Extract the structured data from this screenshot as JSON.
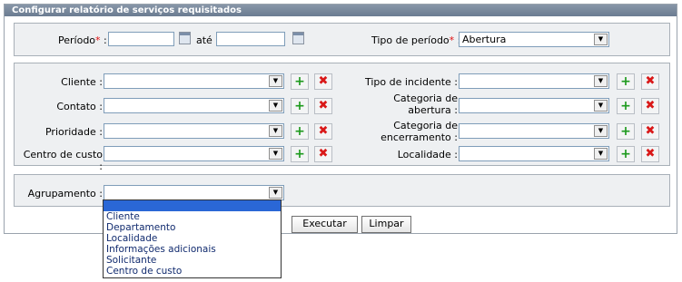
{
  "panel": {
    "title": "Configurar relatório de serviços requisitados"
  },
  "period": {
    "label": "Período",
    "required_mark": "*",
    "colon": ":",
    "ate": "até",
    "start_value": "",
    "end_value": "",
    "type_label": "Tipo de período",
    "type_value": "Abertura"
  },
  "filters": {
    "cliente": {
      "label": "Cliente :",
      "value": ""
    },
    "contato": {
      "label": "Contato :",
      "value": ""
    },
    "prioridade": {
      "label": "Prioridade :",
      "value": ""
    },
    "centro_custo": {
      "label": "Centro de custo :",
      "value": ""
    },
    "tipo_incidente": {
      "label": "Tipo de incidente :",
      "value": ""
    },
    "categoria_abertura": {
      "label_line1": "Categoria de",
      "label_line2": "abertura :",
      "value": ""
    },
    "categoria_encerramento": {
      "label_line1": "Categoria de",
      "label_line2": "encerramento :",
      "value": ""
    },
    "localidade": {
      "label": "Localidade :",
      "value": ""
    }
  },
  "grouping": {
    "label": "Agrupamento :",
    "value": "",
    "options": [
      "",
      "Cliente",
      "Departamento",
      "Localidade",
      "Informações adicionais",
      "Solicitante",
      "Centro de custo"
    ]
  },
  "buttons": {
    "executar": "Executar",
    "limpar": "Limpar"
  },
  "icons": {
    "add": "add-icon",
    "remove": "remove-icon",
    "calendar": "calendar-icon"
  },
  "colors": {
    "header": "#7b8ca1",
    "required": "#e01010",
    "selected_option": "#2a67d6",
    "group_bg": "#eef0f2"
  }
}
